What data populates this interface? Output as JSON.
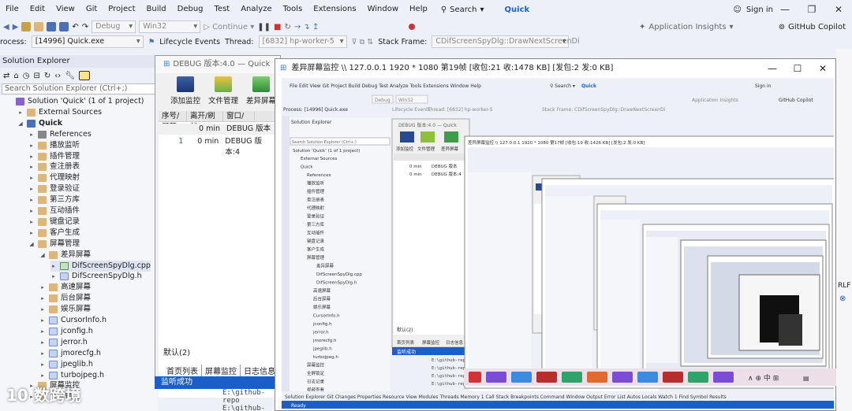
{
  "menu": {
    "items": [
      "File",
      "Edit",
      "View",
      "Git",
      "Project",
      "Build",
      "Debug",
      "Test",
      "Analyze",
      "Tools",
      "Extensions",
      "Window",
      "Help"
    ],
    "search_label": "Search",
    "project_name": "Quick",
    "signin_label": "Sign in"
  },
  "toolbar": {
    "config": "Debug",
    "platform": "Win32",
    "continue_label": "Continue",
    "app_insights": "Application Insights",
    "copilot_label": "GitHub Copilot"
  },
  "procbar": {
    "process_label": "rocess:",
    "process_value": "[14996] Quick.exe",
    "lifecycle_label": "Lifecycle Events",
    "thread_label": "Thread:",
    "thread_value": "[6832] hp-worker-5",
    "stack_label": "Stack Frame:",
    "stack_value": "CDifScreenSpyDlg::DrawNextScreenDi"
  },
  "solution_explorer": {
    "title": "Solution Explorer",
    "search_placeholder": "Search Solution Explorer (Ctrl+;)",
    "items": [
      {
        "label": "Solution 'Quick' (1 of 1 project)",
        "indent": 0,
        "arrow": "",
        "icon": "solution"
      },
      {
        "label": "External Sources",
        "indent": 1,
        "arrow": "▸",
        "icon": "folder"
      },
      {
        "label": "Quick",
        "indent": 1,
        "arrow": "◢",
        "icon": "project",
        "bold": true
      },
      {
        "label": "References",
        "indent": 2,
        "arrow": "▸",
        "icon": "ref"
      },
      {
        "label": "播放监听",
        "indent": 2,
        "arrow": "▸",
        "icon": "folder"
      },
      {
        "label": "插件管理",
        "indent": 2,
        "arrow": "▸",
        "icon": "folder"
      },
      {
        "label": "查注册表",
        "indent": 2,
        "arrow": "▸",
        "icon": "folder"
      },
      {
        "label": "代理映射",
        "indent": 2,
        "arrow": "▸",
        "icon": "folder"
      },
      {
        "label": "登录验证",
        "indent": 2,
        "arrow": "▸",
        "icon": "folder"
      },
      {
        "label": "第三方库",
        "indent": 2,
        "arrow": "▸",
        "icon": "folder"
      },
      {
        "label": "互动插件",
        "indent": 2,
        "arrow": "▸",
        "icon": "folder"
      },
      {
        "label": "键盘记录",
        "indent": 2,
        "arrow": "▸",
        "icon": "folder"
      },
      {
        "label": "客户生成",
        "indent": 2,
        "arrow": "▸",
        "icon": "folder"
      },
      {
        "label": "屏幕管理",
        "indent": 2,
        "arrow": "◢",
        "icon": "folder"
      },
      {
        "label": "差异屏幕",
        "indent": 3,
        "arrow": "◢",
        "icon": "folder"
      },
      {
        "label": "DifScreenSpyDlg.cpp",
        "indent": 4,
        "arrow": "▸",
        "icon": "cpp"
      },
      {
        "label": "DifScreenSpyDlg.h",
        "indent": 4,
        "arrow": "▸",
        "icon": "h"
      },
      {
        "label": "高速屏幕",
        "indent": 3,
        "arrow": "▸",
        "icon": "folder"
      },
      {
        "label": "后台屏幕",
        "indent": 3,
        "arrow": "▸",
        "icon": "folder"
      },
      {
        "label": "娱乐屏幕",
        "indent": 3,
        "arrow": "▸",
        "icon": "folder"
      },
      {
        "label": "CursorInfo.h",
        "indent": 3,
        "arrow": "▸",
        "icon": "h"
      },
      {
        "label": "jconfig.h",
        "indent": 3,
        "arrow": "▸",
        "icon": "h"
      },
      {
        "label": "jerror.h",
        "indent": 3,
        "arrow": "▸",
        "icon": "h"
      },
      {
        "label": "jmorecfg.h",
        "indent": 3,
        "arrow": "▸",
        "icon": "h"
      },
      {
        "label": "jpeglib.h",
        "indent": 3,
        "arrow": "▸",
        "icon": "h"
      },
      {
        "label": "turbojpeg.h",
        "indent": 3,
        "arrow": "▸",
        "icon": "h"
      },
      {
        "label": "屏幕监控",
        "indent": 2,
        "arrow": "▸",
        "icon": "folder"
      },
      {
        "label": "全屏锁定",
        "indent": 2,
        "arrow": "▸",
        "icon": "folder"
      }
    ]
  },
  "debug_window": {
    "title": "DEBUG 版本:4.0   —  Quick",
    "buttons": [
      "添加监控",
      "文件管理",
      "差异屏幕"
    ],
    "columns": [
      "序号/屏幕",
      "离开/刷新",
      "窗口/"
    ],
    "rows": [
      {
        "index": "",
        "time": "0 min",
        "text": "DEBUG 版本"
      },
      {
        "index": "1",
        "time": "0 min",
        "text": "DEBUG 版本:4"
      }
    ],
    "log_tab": "默认(2)",
    "bottom_tabs": [
      "首页列表",
      "屏幕监控",
      "日志信息"
    ],
    "status": "监听成功"
  },
  "output_lines": [
    "E:\\github-repo",
    "E:\\github-repo"
  ],
  "remote_window": {
    "title": "差异屏幕监控 \\\\ 127.0.0.1  1920 * 1080 第19帧  [收包:21 收:1478 KB] [发包:2 发:0 KB]",
    "inner_menu": [
      "File",
      "Edit",
      "View",
      "Git",
      "Project",
      "Build",
      "Debug",
      "Test",
      "Analyze",
      "Tools",
      "Extensions",
      "Window",
      "Help"
    ],
    "inner_process": "Process: [14996] Quick.exe",
    "inner_lifecycle": "Lifecycle Events",
    "inner_thread": "Thread: [6832] hp-worker-5",
    "inner_stack": "Stack Frame: CDifScreenSpyDlg::DrawNextScreenDi",
    "inner_se_title": "Solution Explorer",
    "inner_se_search": "Search Solution Explorer (Ctrl+;)",
    "inner_solution": "Solution 'Quick' (1 of 1 project)",
    "inner_debug_title": "DEBUG 版本:4.0 — Quick",
    "inner_debug_buttons": [
      "添加监控",
      "文件管理",
      "差异屏幕"
    ],
    "inner_rows": [
      {
        "time": "0 min",
        "text": "DEBUG 版本"
      },
      {
        "time": "0 min",
        "text": "DEBUG 版本:4"
      }
    ],
    "inner_logtab": "默认(2)",
    "inner_tabs": [
      "首页列表",
      "屏幕监控",
      "日志信息"
    ],
    "inner_status": "监听成功",
    "inner_bottom_tabs": [
      "Solution Explorer",
      "Git Changes",
      "Properties",
      "Resource View",
      "Modules",
      "Threads",
      "Memory 1",
      "Call Stack",
      "Breakpoints",
      "Command Window",
      "Output",
      "Error List",
      "Autos",
      "Locals",
      "Watch 1",
      "Find Symbol Results"
    ],
    "inner_ready": "Ready",
    "nested_title": "差异屏幕监控 \\\\ 127.0.0.1  1920 * 1080 第17帧 [收包:19 收:1426 KB] [发包:2 发:0 KB]",
    "inner_folders": [
      "External Sources",
      "Quick",
      "References",
      "播放监听",
      "插件管理",
      "查注册表",
      "代理映射",
      "登录验证",
      "第三方库",
      "互动插件",
      "键盘记录",
      "客户生成",
      "屏幕管理",
      "差异屏幕",
      "DifScreenSpyDlg.cpp",
      "DifScreenSpyDlg.h",
      "高速屏幕",
      "后台屏幕",
      "娱乐屏幕",
      "CursorInfo.h",
      "jconfig.h",
      "jerror.h",
      "jmorecfg.h",
      "jpeglib.h",
      "turbojpeg.h",
      "屏幕监控",
      "全屏锁定",
      "日志记录",
      "视频查看"
    ]
  },
  "watermark": "10 数跨境",
  "right_labels": [
    "RLF",
    "⊗"
  ],
  "colors": {
    "accent": "#1a5ec9",
    "taskbar": "#ecdfe8",
    "ide_bg": "#eef0f8"
  }
}
